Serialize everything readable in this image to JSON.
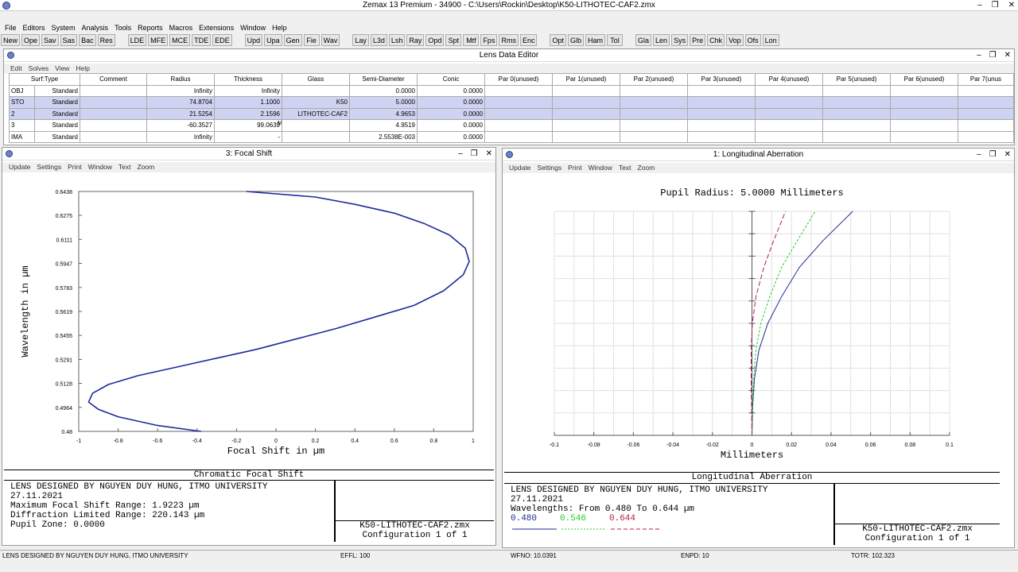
{
  "app": {
    "title": "Zemax 13 Premium - 34900 - C:\\Users\\Rockin\\Desktop\\K50-LITHOTEC-CAF2.zmx",
    "win_buttons": [
      "–",
      "❐",
      "✕"
    ]
  },
  "menu": [
    "File",
    "Editors",
    "System",
    "Analysis",
    "Tools",
    "Reports",
    "Macros",
    "Extensions",
    "Window",
    "Help"
  ],
  "toolbar": {
    "group1": [
      "New",
      "Ope",
      "Sav",
      "Sas",
      "Bac",
      "Res"
    ],
    "group2": [
      "LDE",
      "MFE",
      "MCE",
      "TDE",
      "EDE"
    ],
    "group3": [
      "Upd",
      "Upa",
      "Gen",
      "Fie",
      "Wav"
    ],
    "group4": [
      "Lay",
      "L3d",
      "Lsh",
      "Ray",
      "Opd",
      "Spt",
      "Mtf",
      "Fps",
      "Rms",
      "Enc"
    ],
    "group5": [
      "Opt",
      "Glb",
      "Ham",
      "Tol"
    ],
    "group6": [
      "Gla",
      "Len",
      "Sys",
      "Pre",
      "Chk",
      "Vop",
      "Ofs",
      "Lon"
    ]
  },
  "lde": {
    "title": "Lens Data Editor",
    "menu": [
      "Edit",
      "Solves",
      "View",
      "Help"
    ],
    "headers": [
      "Surf:Type",
      "Comment",
      "Radius",
      "Thickness",
      "Glass",
      "Semi-Diameter",
      "Conic",
      "Par 0(unused)",
      "Par 1(unused)",
      "Par 2(unused)",
      "Par 3(unused)",
      "Par 4(unused)",
      "Par 5(unused)",
      "Par 6(unused)",
      "Par 7(unus"
    ],
    "rows": [
      {
        "surf": "OBJ",
        "type": "Standard",
        "comment": "",
        "radius": "Infinity",
        "thickness": "Infinity",
        "tmark": "",
        "glass": "",
        "semi": "0.0000",
        "conic": "0.0000",
        "sel": false
      },
      {
        "surf": "STO",
        "type": "Standard",
        "comment": "",
        "radius": "74.8704",
        "thickness": "1.1000",
        "tmark": "",
        "glass": "K50",
        "semi": "5.0000",
        "conic": "0.0000",
        "sel": true
      },
      {
        "surf": "2",
        "type": "Standard",
        "comment": "",
        "radius": "21.5254",
        "thickness": "2.1596",
        "tmark": "",
        "glass": "LITHOTEC-CAF2",
        "semi": "4.9653",
        "conic": "0.0000",
        "sel": true
      },
      {
        "surf": "3",
        "type": "Standard",
        "comment": "",
        "radius": "-60.3527",
        "thickness": "99.0639",
        "tmark": "M",
        "glass": "",
        "semi": "4.9519",
        "conic": "0.0000",
        "sel": false
      },
      {
        "surf": "IMA",
        "type": "Standard",
        "comment": "",
        "radius": "Infinity",
        "thickness": "-",
        "tmark": "",
        "glass": "",
        "semi": "2.5538E-003",
        "conic": "0.0000",
        "sel": false
      }
    ]
  },
  "focal": {
    "title": "3: Focal Shift",
    "menu": [
      "Update",
      "Settings",
      "Print",
      "Window",
      "Text",
      "Zoom"
    ],
    "footer_title": "Chromatic Focal Shift",
    "info": [
      "LENS DESIGNED BY NGUYEN DUY HUNG, ITMO UNIVERSITY",
      "27.11.2021",
      "Maximum Focal Shift Range: 1.9223 µm",
      "Diffraction Limited Range: 220.143 µm",
      "Pupil Zone: 0.0000"
    ],
    "file": "K50-LITHOTEC-CAF2.zmx",
    "config": "Configuration 1 of 1"
  },
  "longab": {
    "title": "1: Longitudinal Aberration",
    "menu": [
      "Update",
      "Settings",
      "Print",
      "Window",
      "Text",
      "Zoom"
    ],
    "footer_title": "Longitudinal Aberration",
    "info": [
      "LENS DESIGNED BY NGUYEN DUY HUNG, ITMO UNIVERSITY",
      "27.11.2021",
      "Wavelengths: From 0.480 To 0.644 µm"
    ],
    "wl_labels": [
      "0.480",
      "0.546",
      "0.644"
    ],
    "file": "K50-LITHOTEC-CAF2.zmx",
    "config": "Configuration 1 of 1"
  },
  "status": {
    "left": "LENS DESIGNED BY NGUYEN DUY HUNG, ITMO UNIVERSITY",
    "effl": "EFFL: 100",
    "wfno": "WFNO: 10.0391",
    "enpd": "ENPD: 10",
    "totr": "TOTR: 102.323"
  },
  "colors": {
    "blue": "#1f2a9b",
    "green": "#22cc22",
    "red": "#b0203c"
  },
  "chart_data": [
    {
      "type": "line",
      "title": "",
      "xlabel": "Focal Shift in µm",
      "ylabel": "Wavelength in µm",
      "xlim": [
        -1,
        1
      ],
      "ylim": [
        0.48,
        0.6438
      ],
      "x_ticks": [
        "-1",
        "-0.8",
        "-0.6",
        "-0.4",
        "-0.2",
        "0",
        "0.2",
        "0.4",
        "0.6",
        "0.8",
        "1"
      ],
      "y_ticks": [
        "0.48",
        "0.4964",
        "0.5128",
        "0.5291",
        "0.5455",
        "0.5619",
        "0.5783",
        "0.5947",
        "0.6111",
        "0.6275",
        "0.6438"
      ],
      "series": [
        {
          "x": [
            -0.38,
            -0.6,
            -0.8,
            -0.9,
            -0.95,
            -0.93,
            -0.85,
            -0.7,
            -0.5,
            -0.3,
            -0.1,
            0.1,
            0.3,
            0.5,
            0.7,
            0.85,
            0.95,
            0.98,
            0.96,
            0.88,
            0.75,
            0.6,
            0.4,
            0.2,
            -0.15
          ],
          "y": [
            0.48,
            0.484,
            0.49,
            0.495,
            0.5,
            0.506,
            0.512,
            0.518,
            0.524,
            0.53,
            0.536,
            0.543,
            0.55,
            0.558,
            0.566,
            0.576,
            0.587,
            0.596,
            0.605,
            0.614,
            0.622,
            0.629,
            0.635,
            0.64,
            0.6438
          ]
        }
      ]
    },
    {
      "type": "line",
      "title": "Pupil Radius: 5.0000 Millimeters",
      "xlabel": "Millimeters",
      "xlim": [
        -0.1,
        0.1
      ],
      "ylim": [
        0,
        1
      ],
      "x_ticks": [
        "-0.1",
        "-0.08",
        "-0.06",
        "-0.04",
        "-0.02",
        "0",
        "0.02",
        "0.04",
        "0.06",
        "0.08",
        "0.1"
      ],
      "series": [
        {
          "name": "0.480",
          "x": [
            0,
            0.0003,
            0.0012,
            0.0035,
            0.008,
            0.015,
            0.024,
            0.036,
            0.051
          ],
          "y": [
            0,
            0.12,
            0.25,
            0.38,
            0.5,
            0.62,
            0.75,
            0.87,
            1
          ]
        },
        {
          "name": "0.546",
          "x": [
            0,
            0.0002,
            0.0008,
            0.002,
            0.0045,
            0.009,
            0.015,
            0.023,
            0.032
          ],
          "y": [
            0,
            0.12,
            0.25,
            0.38,
            0.5,
            0.62,
            0.75,
            0.87,
            1
          ]
        },
        {
          "name": "0.644",
          "x": [
            0,
            -0.0002,
            -0.0004,
            -0.0004,
            0.0002,
            0.002,
            0.006,
            0.011,
            0.017
          ],
          "y": [
            0,
            0.12,
            0.25,
            0.38,
            0.5,
            0.62,
            0.75,
            0.87,
            1
          ]
        }
      ]
    }
  ]
}
